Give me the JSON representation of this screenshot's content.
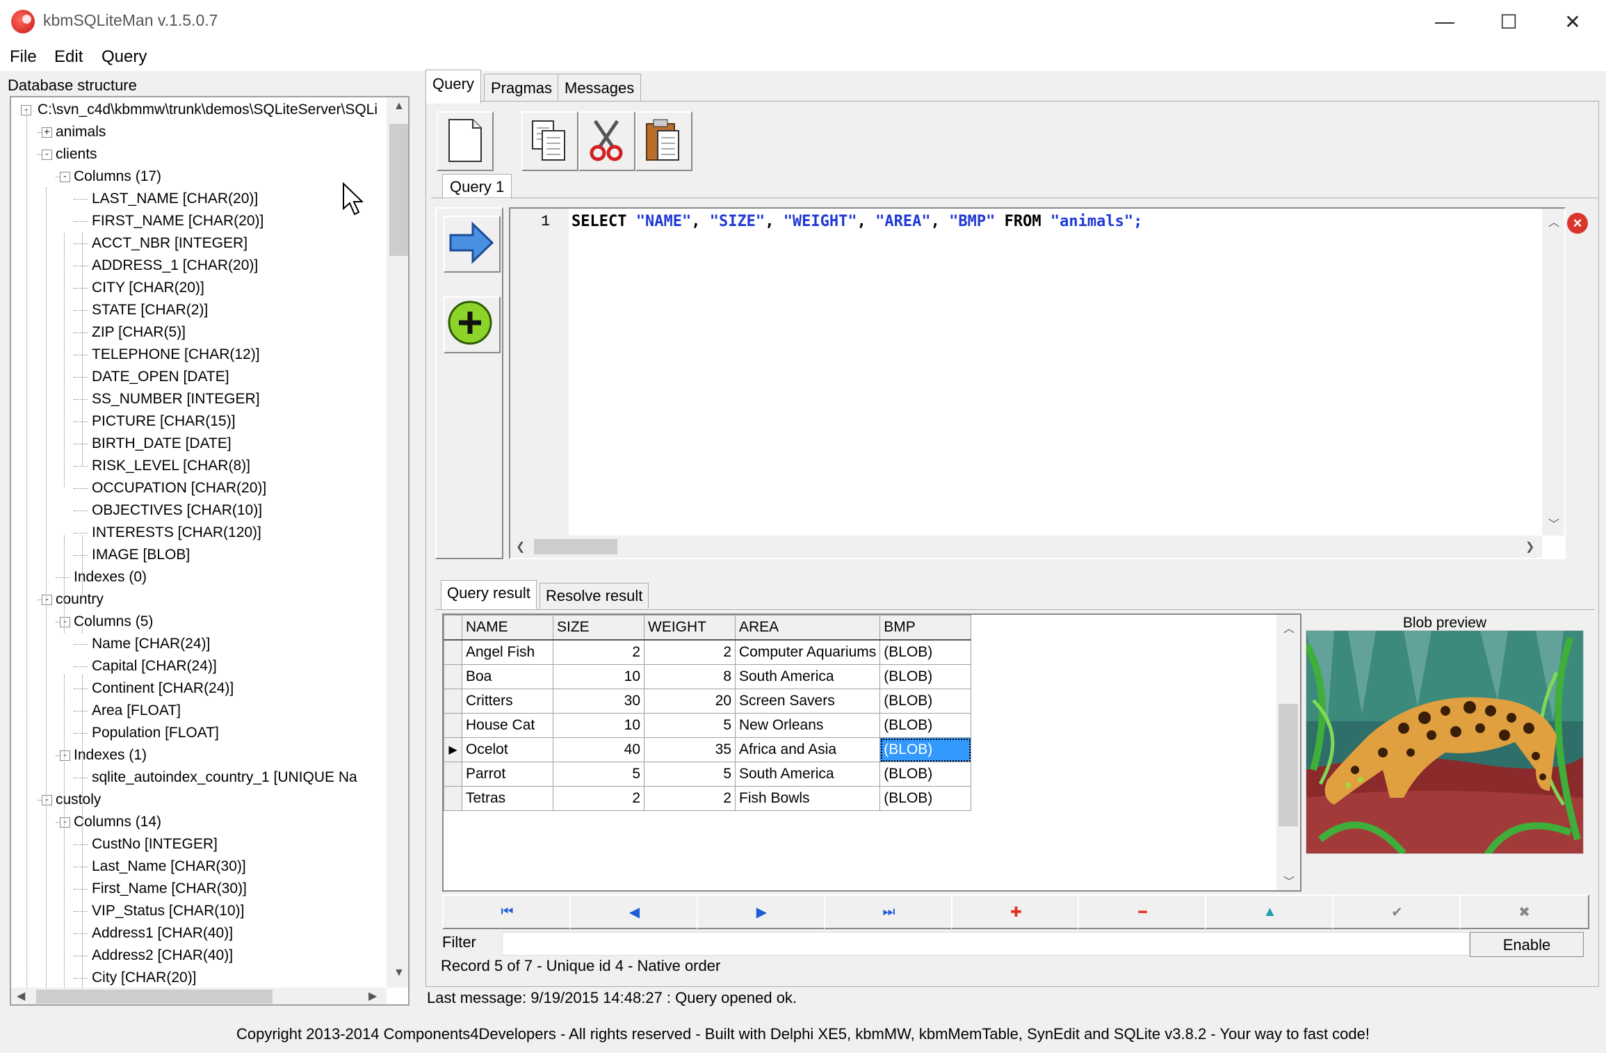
{
  "window": {
    "title": "kbmSQLiteMan v.1.5.0.7",
    "minimize_glyph": "—",
    "maximize_glyph": "☐",
    "close_glyph": "✕"
  },
  "menu": [
    {
      "label": "File"
    },
    {
      "label": "Edit"
    },
    {
      "label": "Query"
    }
  ],
  "left_panel": {
    "label": "Database structure",
    "tree": [
      {
        "text": "C:\\svn_c4d\\kbmmw\\trunk\\demos\\SQLiteServer\\SQLi",
        "level": 0,
        "toggle": "-"
      },
      {
        "text": "animals",
        "level": 1,
        "toggle": "+"
      },
      {
        "text": "clients",
        "level": 1,
        "toggle": "-"
      },
      {
        "text": "Columns (17)",
        "level": 2,
        "toggle": "-"
      },
      {
        "text": "LAST_NAME [CHAR(20)]",
        "level": 3
      },
      {
        "text": "FIRST_NAME [CHAR(20)]",
        "level": 3
      },
      {
        "text": "ACCT_NBR [INTEGER]",
        "level": 3
      },
      {
        "text": "ADDRESS_1 [CHAR(20)]",
        "level": 3
      },
      {
        "text": "CITY [CHAR(20)]",
        "level": 3
      },
      {
        "text": "STATE [CHAR(2)]",
        "level": 3
      },
      {
        "text": "ZIP [CHAR(5)]",
        "level": 3
      },
      {
        "text": "TELEPHONE [CHAR(12)]",
        "level": 3
      },
      {
        "text": "DATE_OPEN [DATE]",
        "level": 3
      },
      {
        "text": "SS_NUMBER [INTEGER]",
        "level": 3
      },
      {
        "text": "PICTURE [CHAR(15)]",
        "level": 3
      },
      {
        "text": "BIRTH_DATE [DATE]",
        "level": 3
      },
      {
        "text": "RISK_LEVEL [CHAR(8)]",
        "level": 3
      },
      {
        "text": "OCCUPATION [CHAR(20)]",
        "level": 3
      },
      {
        "text": "OBJECTIVES [CHAR(10)]",
        "level": 3
      },
      {
        "text": "INTERESTS [CHAR(120)]",
        "level": 3
      },
      {
        "text": "IMAGE [BLOB]",
        "level": 3
      },
      {
        "text": "Indexes (0)",
        "level": 2
      },
      {
        "text": "country",
        "level": 1,
        "toggle": "-"
      },
      {
        "text": "Columns (5)",
        "level": 2,
        "toggle": "-"
      },
      {
        "text": "Name [CHAR(24)]",
        "level": 3
      },
      {
        "text": "Capital [CHAR(24)]",
        "level": 3
      },
      {
        "text": "Continent [CHAR(24)]",
        "level": 3
      },
      {
        "text": "Area [FLOAT]",
        "level": 3
      },
      {
        "text": "Population [FLOAT]",
        "level": 3
      },
      {
        "text": "Indexes (1)",
        "level": 2,
        "toggle": "-"
      },
      {
        "text": "sqlite_autoindex_country_1 [UNIQUE Na",
        "level": 3
      },
      {
        "text": "custoly",
        "level": 1,
        "toggle": "-"
      },
      {
        "text": "Columns (14)",
        "level": 2,
        "toggle": "-"
      },
      {
        "text": "CustNo [INTEGER]",
        "level": 3
      },
      {
        "text": "Last_Name [CHAR(30)]",
        "level": 3
      },
      {
        "text": "First_Name [CHAR(30)]",
        "level": 3
      },
      {
        "text": "VIP_Status [CHAR(10)]",
        "level": 3
      },
      {
        "text": "Address1 [CHAR(40)]",
        "level": 3
      },
      {
        "text": "Address2 [CHAR(40)]",
        "level": 3
      },
      {
        "text": "City [CHAR(20)]",
        "level": 3
      }
    ]
  },
  "tabs": [
    {
      "label": "Query",
      "active": true
    },
    {
      "label": "Pragmas",
      "active": false
    },
    {
      "label": "Messages",
      "active": false
    }
  ],
  "toolbar": [
    "new-document-icon",
    "copy-icon",
    "cut-icon",
    "paste-icon"
  ],
  "query_tab": {
    "label": "Query 1"
  },
  "editor": {
    "line_number": "1",
    "tokens": [
      {
        "t": "SELECT ",
        "c": "kw"
      },
      {
        "t": "\"NAME\"",
        "c": "str"
      },
      {
        "t": ", ",
        "c": "kw"
      },
      {
        "t": "\"SIZE\"",
        "c": "str"
      },
      {
        "t": ", ",
        "c": "kw"
      },
      {
        "t": "\"WEIGHT\"",
        "c": "str"
      },
      {
        "t": ", ",
        "c": "kw"
      },
      {
        "t": "\"AREA\"",
        "c": "str"
      },
      {
        "t": ", ",
        "c": "kw"
      },
      {
        "t": "\"BMP\"",
        "c": "str"
      },
      {
        "t": " FROM ",
        "c": "kw"
      },
      {
        "t": "\"animals\"",
        "c": "str"
      },
      {
        "t": ";",
        "c": "str"
      }
    ],
    "keyword_color": "#000000",
    "string_color": "#1f38d6"
  },
  "result_tabs": [
    {
      "label": "Query result",
      "active": true
    },
    {
      "label": "Resolve result",
      "active": false
    }
  ],
  "grid": {
    "columns": [
      "NAME",
      "SIZE",
      "WEIGHT",
      "AREA",
      "BMP"
    ],
    "rows": [
      [
        "Angel Fish",
        "2",
        "2",
        "Computer Aquariums",
        "(BLOB)"
      ],
      [
        "Boa",
        "10",
        "8",
        "South America",
        "(BLOB)"
      ],
      [
        "Critters",
        "30",
        "20",
        "Screen Savers",
        "(BLOB)"
      ],
      [
        "House Cat",
        "10",
        "5",
        "New Orleans",
        "(BLOB)"
      ],
      [
        "Ocelot",
        "40",
        "35",
        "Africa and Asia",
        "(BLOB)"
      ],
      [
        "Parrot",
        "5",
        "5",
        "South America",
        "(BLOB)"
      ],
      [
        "Tetras",
        "2",
        "2",
        "Fish Bowls",
        "(BLOB)"
      ]
    ],
    "current_row": 4,
    "selected_column": 4,
    "selection_color": "#3399ff"
  },
  "blob_preview": {
    "label": "Blob preview",
    "image": "ocelot-in-jungle"
  },
  "navigator": [
    {
      "name": "nav-first-button",
      "glyph": "⏮",
      "color": "#1e5bd6"
    },
    {
      "name": "nav-prior-button",
      "glyph": "◀",
      "color": "#1e5bd6"
    },
    {
      "name": "nav-next-button",
      "glyph": "▶",
      "color": "#1e5bd6"
    },
    {
      "name": "nav-last-button",
      "glyph": "⏭",
      "color": "#1e5bd6"
    },
    {
      "name": "nav-insert-button",
      "glyph": "✚",
      "color": "#e0301e"
    },
    {
      "name": "nav-delete-button",
      "glyph": "━",
      "color": "#e0301e"
    },
    {
      "name": "nav-edit-button",
      "glyph": "▲",
      "color": "#1a9fb0"
    },
    {
      "name": "nav-post-button",
      "glyph": "✔",
      "color": "#888888"
    },
    {
      "name": "nav-cancel-button",
      "glyph": "✖",
      "color": "#888888"
    }
  ],
  "filter": {
    "label": "Filter",
    "value": "",
    "enable_label": "Enable"
  },
  "record_status": "Record 5 of 7 - Unique id 4 - Native order",
  "last_message": "Last message: 9/19/2015 14:48:27 : Query opened ok.",
  "copyright": "Copyright 2013-2014 Components4Developers - All rights reserved - Built with Delphi XE5, kbmMW, kbmMemTable, SynEdit and SQLite v3.8.2 - Your way to fast code!"
}
